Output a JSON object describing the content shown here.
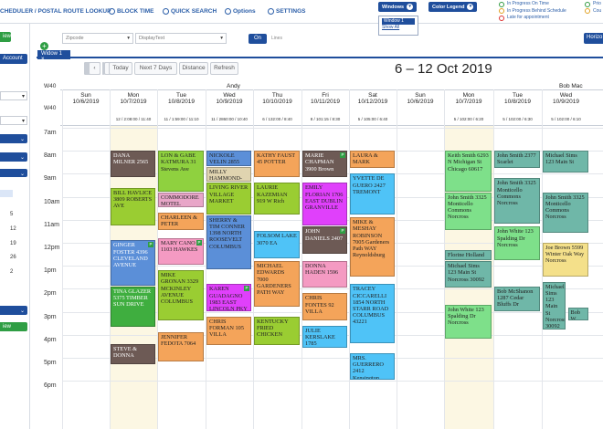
{
  "topbar": {
    "nav": [
      {
        "label": "CHEDULER / POSTAL ROUTE LOOKUP"
      },
      {
        "label": "BLOCK TIME"
      },
      {
        "label": "QUICK SEARCH"
      },
      {
        "label": "Options"
      },
      {
        "label": "SETTINGS"
      }
    ],
    "windows_label": "Windows",
    "windows_list": [
      "Window 1",
      "Show All"
    ],
    "color_legend_label": "Color Legend",
    "legend": [
      "In Progress On Time",
      "In Progress Behind Schedule",
      "Late for appointment"
    ],
    "legend_right": [
      "Prio",
      "Cou"
    ]
  },
  "left": {
    "buttons": [
      "iew",
      "Account",
      "iew"
    ],
    "numbers": [
      "5",
      "12",
      "19",
      "26",
      "2"
    ]
  },
  "toolbar": {
    "zip_placeholder": "Zipcode",
    "display_placeholder": "DisplayText",
    "on_label": "On",
    "off_label": "Lines",
    "horizontal_label": "Horizo"
  },
  "tabs": {
    "window1": "Widow 1"
  },
  "nav": {
    "today": "Today",
    "next7": "Next 7 Days",
    "distance": "Distance",
    "refresh": "Refresh",
    "range": "6 – 12 Oct 2019"
  },
  "week": {
    "w40a": "W40",
    "w40b": "W40"
  },
  "people": [
    "Andy",
    "Bob Mac"
  ],
  "days": [
    {
      "d": "Sun",
      "date": "10/6/2019",
      "stat": ""
    },
    {
      "d": "Mon",
      "date": "10/7/2019",
      "stat": "12 / 2:08:00 / 11:40"
    },
    {
      "d": "Tue",
      "date": "10/8/2019",
      "stat": "11 / 1:59:00 / 11:10"
    },
    {
      "d": "Wed",
      "date": "10/9/2019",
      "stat": "11 / 2860:00 / 10:40"
    },
    {
      "d": "Thu",
      "date": "10/10/2019",
      "stat": "6 / 132:00 / 8:40"
    },
    {
      "d": "Fri",
      "date": "10/11/2019",
      "stat": "8 / 101:15 / 8:30"
    },
    {
      "d": "Sat",
      "date": "10/12/2019",
      "stat": "5 / 105:00 / 6:40"
    },
    {
      "d": "Sun",
      "date": "10/6/2019",
      "stat": ""
    },
    {
      "d": "Mon",
      "date": "10/7/2019",
      "stat": "5 / 102:00 / 6:20"
    },
    {
      "d": "Tue",
      "date": "10/8/2019",
      "stat": "5 / 102:00 / 6:30"
    },
    {
      "d": "Wed",
      "date": "10/9/2019",
      "stat": "5 / 102:00 / 6:10"
    }
  ],
  "times": [
    "7am",
    "8am",
    "9am",
    "10am",
    "11am",
    "12pm",
    "1pm",
    "2pm",
    "3pm",
    "4pm",
    "5pm",
    "6pm"
  ],
  "appointments": [
    {
      "text": "DANA MILNER 2565",
      "col": 1,
      "start": 8.0,
      "end": 9.2,
      "color": "#6d5a55",
      "fg": "#fff"
    },
    {
      "text": "BILL HAVLICE 3809 ROBERTS AVE",
      "col": 1,
      "start": 9.6,
      "end": 11.3,
      "color": "#9acd32",
      "fg": "#222"
    },
    {
      "text": "GINGER FOSTER 4396 CLEVELAND AVENUE",
      "col": 1,
      "start": 11.9,
      "end": 13.9,
      "color": "#5b8fd8",
      "fg": "#fff",
      "badge": true
    },
    {
      "text": "TINA GLAZER 5375 TIMBER SUN DRIVE",
      "col": 1,
      "start": 13.9,
      "end": 15.7,
      "color": "#3fae3f",
      "fg": "#fff"
    },
    {
      "text": "STEVE & DONNA",
      "col": 1,
      "start": 16.4,
      "end": 17.3,
      "color": "#6d5a55",
      "fg": "#fff"
    },
    {
      "text": "LON & GABE KATMURA 31 Stevens Ave",
      "col": 2,
      "start": 8.0,
      "end": 9.8,
      "color": "#8fd13f",
      "fg": "#222"
    },
    {
      "text": "COMMODORE MOTEL",
      "col": 2,
      "start": 9.8,
      "end": 10.5,
      "color": "#e8a6c8",
      "fg": "#222"
    },
    {
      "text": "CHARLEEN & PETER",
      "col": 2,
      "start": 10.7,
      "end": 11.5,
      "color": "#f4a45a",
      "fg": "#222"
    },
    {
      "text": "MARY CANO 1103 HAWKES",
      "col": 2,
      "start": 11.8,
      "end": 13.0,
      "color": "#f49ac2",
      "fg": "#222",
      "badge": true
    },
    {
      "text": "MIKE GRONAN 3329 MCKINLEY AVENUE COLUMBUS",
      "col": 2,
      "start": 13.2,
      "end": 15.4,
      "color": "#9acd32",
      "fg": "#222"
    },
    {
      "text": "JENNIFER FEDOTA 7064",
      "col": 2,
      "start": 15.9,
      "end": 17.2,
      "color": "#f4a45a",
      "fg": "#222"
    },
    {
      "text": "NICKOLE VELIN 2855",
      "col": 3,
      "start": 8.0,
      "end": 8.7,
      "color": "#5b8fd8",
      "fg": "#222"
    },
    {
      "text": "MILLY HAMMOND-PRO",
      "col": 3,
      "start": 8.7,
      "end": 9.4,
      "color": "#e0d4b0",
      "fg": "#222"
    },
    {
      "text": "LIVING RIVER VILLAGE MARKET",
      "col": 3,
      "start": 9.4,
      "end": 10.8,
      "color": "#9acd32",
      "fg": "#222"
    },
    {
      "text": "SHERRY & TIM CONNER 1398 NORTH ROOSEVELT COLUMBUS",
      "col": 3,
      "start": 10.8,
      "end": 13.2,
      "color": "#5b8fd8",
      "fg": "#222"
    },
    {
      "text": "KAREN GUADAGNO 1983 EAST LINCOLN PKY",
      "col": 3,
      "start": 13.8,
      "end": 15.0,
      "color": "#e040fb",
      "fg": "#222",
      "badge": true
    },
    {
      "text": "CHRIS FORMAN 105 VILLA",
      "col": 3,
      "start": 15.2,
      "end": 16.5,
      "color": "#f4a45a",
      "fg": "#222"
    },
    {
      "text": "KATHY FAUST 45 POTTER",
      "col": 4,
      "start": 8.0,
      "end": 9.2,
      "color": "#f4a45a",
      "fg": "#222"
    },
    {
      "text": "LAURIE KAZEMIAN 919 W Rich",
      "col": 4,
      "start": 9.4,
      "end": 10.8,
      "color": "#9acd32",
      "fg": "#222"
    },
    {
      "text": "FOLSOM LAKE 3070 EA",
      "col": 4,
      "start": 11.5,
      "end": 12.7,
      "color": "#4fc3f7",
      "fg": "#222"
    },
    {
      "text": "MICHAEL EDWARDS 7000 GARDENERS PATH WAY",
      "col": 4,
      "start": 12.8,
      "end": 14.8,
      "color": "#f4a45a",
      "fg": "#222"
    },
    {
      "text": "KENTUCKY FRIED CHICKEN",
      "col": 4,
      "start": 15.2,
      "end": 16.5,
      "color": "#9acd32",
      "fg": "#222"
    },
    {
      "text": "MARIE CHAPMAN 3900 Brown",
      "col": 5,
      "start": 8.0,
      "end": 9.2,
      "color": "#6d5a55",
      "fg": "#fff",
      "badge": true
    },
    {
      "text": "EMILY FLORIAN 1706 EAST DUBLIN GRANVILLE",
      "col": 5,
      "start": 9.4,
      "end": 11.3,
      "color": "#e040fb",
      "fg": "#222"
    },
    {
      "text": "JOHN DANIELS 2407",
      "col": 5,
      "start": 11.3,
      "end": 12.5,
      "color": "#6d5a55",
      "fg": "#fff",
      "badge": true
    },
    {
      "text": "DONNA HADEN 1596",
      "col": 5,
      "start": 12.8,
      "end": 14.0,
      "color": "#f49ac2",
      "fg": "#222"
    },
    {
      "text": "CHRIS FONTES 92 VILLA",
      "col": 5,
      "start": 14.2,
      "end": 15.4,
      "color": "#f4a45a",
      "fg": "#222"
    },
    {
      "text": "JULIE KERSLAKE 1785",
      "col": 5,
      "start": 15.6,
      "end": 16.6,
      "color": "#4fc3f7",
      "fg": "#222"
    },
    {
      "text": "LAURA & MARK",
      "col": 6,
      "start": 8.0,
      "end": 8.8,
      "color": "#f4a45a",
      "fg": "#222"
    },
    {
      "text": "YVETTE DE GUERO 2427 TREMONT",
      "col": 6,
      "start": 9.0,
      "end": 10.8,
      "color": "#4fc3f7",
      "fg": "#222"
    },
    {
      "text": "MIKE & MESHAY ROBINSON 7005 Gardeners Path WAY Reynoldsburg",
      "col": 6,
      "start": 10.9,
      "end": 13.5,
      "color": "#f4a45a",
      "fg": "#222"
    },
    {
      "text": "TRACEY CICCARELLI 1854 NORTH STARR ROAD COLUMBUS 43221",
      "col": 6,
      "start": 13.8,
      "end": 16.4,
      "color": "#4fc3f7",
      "fg": "#222"
    },
    {
      "text": "MRS. GUERRERO 2412 Kensington",
      "col": 6,
      "start": 16.8,
      "end": 18.0,
      "color": "#4fc3f7",
      "fg": "#222"
    },
    {
      "text": "Keith Smith 6293 N Michigan St Chicago 60617",
      "col": 8,
      "start": 8.0,
      "end": 9.8,
      "color": "#7ee08a",
      "fg": "#222"
    },
    {
      "text": "John Smith 3325 Monticello Commons Norcross",
      "col": 8,
      "start": 9.8,
      "end": 11.5,
      "color": "#7ee08a",
      "fg": "#222"
    },
    {
      "text": "Florine Holland",
      "col": 8,
      "start": 12.3,
      "end": 12.8,
      "color": "#6fb7a8",
      "fg": "#222"
    },
    {
      "text": "Michael Sims 123 Main St Norcross 30092",
      "col": 8,
      "start": 12.8,
      "end": 14.0,
      "color": "#6fb7a8",
      "fg": "#222"
    },
    {
      "text": "John White 123 Spalding Dr Norcross",
      "col": 8,
      "start": 14.7,
      "end": 16.2,
      "color": "#7ee08a",
      "fg": "#222"
    },
    {
      "text": "John Smith 2377 Scarlet",
      "col": 9,
      "start": 8.0,
      "end": 8.8,
      "color": "#6fb7a8",
      "fg": "#222"
    },
    {
      "text": "John Smith 3325 Monticello Commons Norcross",
      "col": 9,
      "start": 9.2,
      "end": 11.2,
      "color": "#6fb7a8",
      "fg": "#222"
    },
    {
      "text": "John White 123 Spalding Dr Norcross",
      "col": 9,
      "start": 11.3,
      "end": 12.8,
      "color": "#7ee08a",
      "fg": "#222"
    },
    {
      "text": "Bob McShanon 1287 Cedar Bluffs Dr",
      "col": 9,
      "start": 13.9,
      "end": 15.0,
      "color": "#6fb7a8",
      "fg": "#222"
    },
    {
      "text": "Michael Sims 123 Main St",
      "col": 10,
      "start": 8.0,
      "end": 9.0,
      "color": "#6fb7a8",
      "fg": "#222"
    },
    {
      "text": "John Smith 3325 Monticello Commons Norcross",
      "col": 10,
      "start": 9.8,
      "end": 11.6,
      "color": "#6fb7a8",
      "fg": "#222"
    },
    {
      "text": "Joe Brown 5599 Winter Oak Way Norcross",
      "col": 10,
      "start": 12.0,
      "end": 13.5,
      "color": "#f4e08a",
      "fg": "#222"
    },
    {
      "text": "Michael Sims 123 Main St Norcross 30092",
      "col": 10,
      "start": 13.7,
      "end": 15.8,
      "color": "#6fb7a8",
      "fg": "#222",
      "narrow": true
    },
    {
      "text": "Bob W",
      "col": 10,
      "start": 14.8,
      "end": 15.4,
      "color": "#6fb7a8",
      "fg": "#222",
      "narrowRight": true
    }
  ]
}
